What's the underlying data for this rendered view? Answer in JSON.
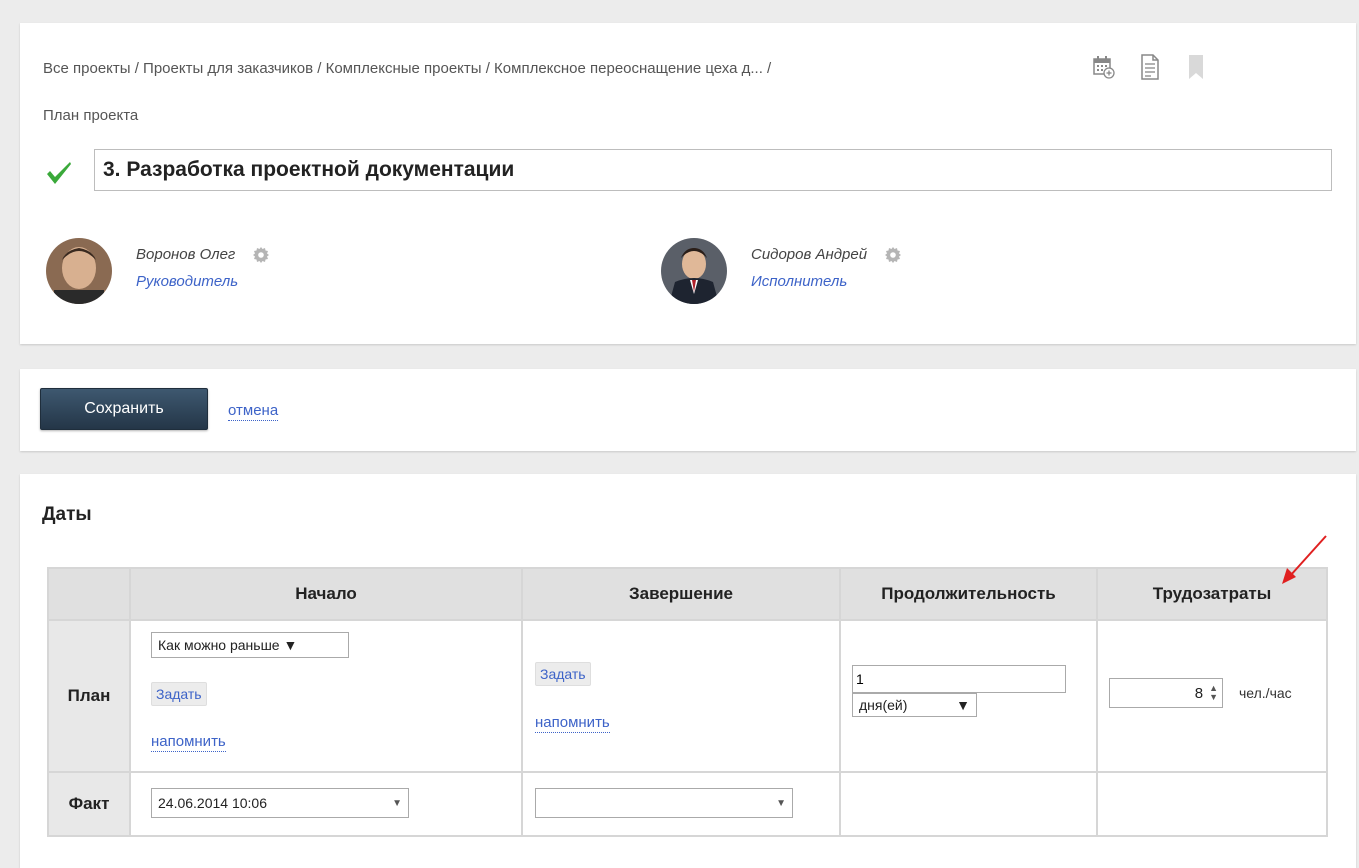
{
  "breadcrumb": {
    "path": "Все проекты / Проекты для заказчиков / Комплексные проекты / Комплексное переоснащение цеха д... /",
    "current": "План проекта"
  },
  "header_icons": [
    "calendar-add-icon",
    "document-icon",
    "bookmark-icon"
  ],
  "task": {
    "title": "3. Разработка проектной документации",
    "status_icon": "checkmark-icon",
    "status_color": "#3aa93a"
  },
  "people": [
    {
      "name": "Воронов Олег",
      "role": "Руководитель"
    },
    {
      "name": "Сидоров Андрей",
      "role": "Исполнитель"
    }
  ],
  "actions": {
    "save_label": "Сохранить",
    "cancel_label": "отмена"
  },
  "dates": {
    "section_title": "Даты",
    "columns": [
      "Начало",
      "Завершение",
      "Продолжительность",
      "Трудозатраты"
    ],
    "plan": {
      "label": "План",
      "start_mode": "Как можно раньше ▼",
      "set_label": "Задать",
      "remind_label": "напомнить",
      "end_set_label": "Задать",
      "end_remind_label": "напомнить",
      "duration_value": "1",
      "duration_unit": "дня(ей)",
      "effort_value": "8",
      "effort_unit": "чел./час"
    },
    "fact": {
      "label": "Факт",
      "start_value": "24.06.2014 10:06",
      "end_value": ""
    }
  },
  "colors": {
    "link": "#3d63c8",
    "save_button": "#2e4358",
    "annotation_arrow": "#e02020"
  }
}
